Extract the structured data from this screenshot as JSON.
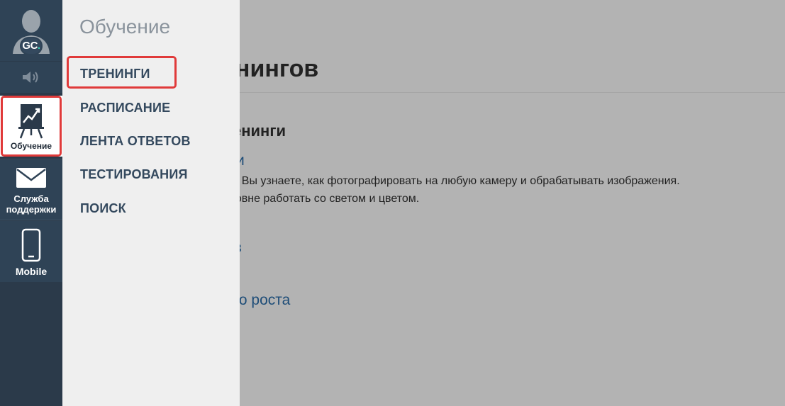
{
  "rail": {
    "avatar_initials": "GC",
    "avatar_dot": ".",
    "items": [
      {
        "label": "Обучение",
        "icon": "chart-easel-icon",
        "active": true
      },
      {
        "label_line1": "Служба",
        "label_line2": "поддержки",
        "icon": "envelope-icon"
      },
      {
        "label": "Mobile",
        "icon": "smartphone-icon"
      }
    ]
  },
  "flyout": {
    "title": "Обучение",
    "items": [
      "ТРЕНИНГИ",
      "РАСПИСАНИЕ",
      "ЛЕНТА ОТВЕТОВ",
      "ТЕСТИРОВАНИЯ",
      "ПОИСК"
    ]
  },
  "page": {
    "heading": "енингов",
    "section": "енинги",
    "link1": "и",
    "desc_line1": "а. Вы узнаете, как фотографировать на любую камеру и обрабатывать изображения.",
    "desc_line2": "ровне работать со светом и цветом.",
    "link2": "ов",
    "link3": "ого роста"
  },
  "colors": {
    "rail_bg": "#2b3a4a",
    "rail_item_bg": "#2f4356",
    "flyout_bg": "#efefef",
    "highlight": "#e03a3a",
    "menu_text": "#34495e",
    "link": "#1e4d78",
    "overlay": "#b3b3b3"
  }
}
